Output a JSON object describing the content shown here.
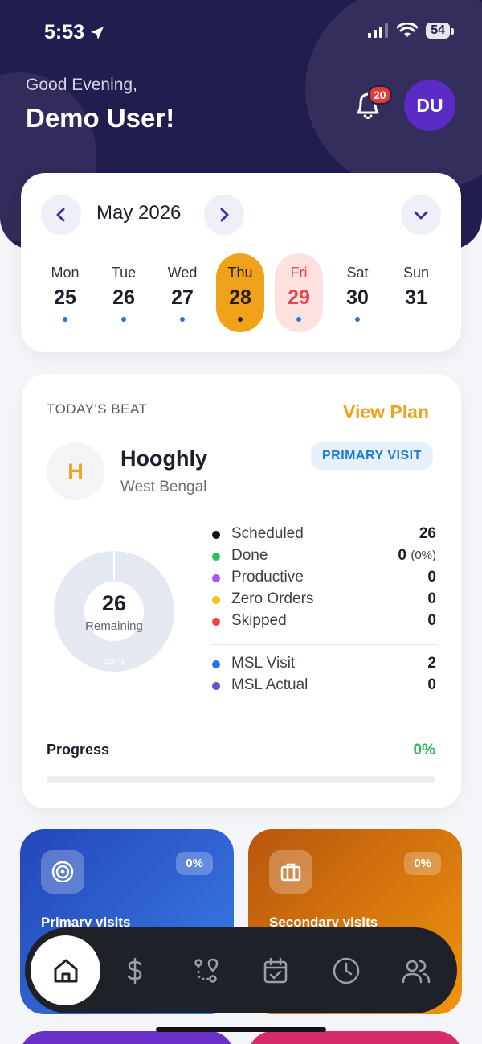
{
  "status_bar": {
    "time": "5:53",
    "battery": "54"
  },
  "header": {
    "greeting": "Good Evening,",
    "user_name": "Demo User!",
    "notification_count": "20",
    "avatar_initials": "DU"
  },
  "calendar": {
    "month_label": "May 2026",
    "days": [
      {
        "name": "Mon",
        "num": "25"
      },
      {
        "name": "Tue",
        "num": "26"
      },
      {
        "name": "Wed",
        "num": "27"
      },
      {
        "name": "Thu",
        "num": "28"
      },
      {
        "name": "Fri",
        "num": "29"
      },
      {
        "name": "Sat",
        "num": "30"
      },
      {
        "name": "Sun",
        "num": "31"
      }
    ],
    "selected_day": "Thu",
    "colors": {
      "selected": "#f0a21b",
      "today_bg": "#fde1df",
      "today_text": "#e5484d",
      "dot": "#2176e6"
    }
  },
  "beat": {
    "section_label": "TODAY'S BEAT",
    "view_plan": "View Plan",
    "initial": "H",
    "name": "Hooghly",
    "state": "West Bengal",
    "visit_type": "PRIMARY VISIT",
    "donut": {
      "count": "26",
      "label": "Remaining",
      "percent_label": "100 %",
      "remaining_fraction": 1.0
    },
    "stats": [
      {
        "label": "Scheduled",
        "value": "26",
        "color": "#111111"
      },
      {
        "label": "Done",
        "value": "0",
        "extra": "(0%)",
        "color": "#2ec05a"
      },
      {
        "label": "Productive",
        "value": "0",
        "color": "#a855f7"
      },
      {
        "label": "Zero Orders",
        "value": "0",
        "color": "#f5c518"
      },
      {
        "label": "Skipped",
        "value": "0",
        "color": "#ef4444"
      }
    ],
    "msl": [
      {
        "label": "MSL Visit",
        "value": "2",
        "color": "#2176e6"
      },
      {
        "label": "MSL Actual",
        "value": "0",
        "color": "#6a4fd0"
      }
    ],
    "progress_label": "Progress",
    "progress_percent": "0%",
    "progress_value": 0
  },
  "tiles": [
    {
      "title": "Primary visits",
      "percent": "0%",
      "icon": "target-icon"
    },
    {
      "title": "Secondary visits",
      "percent": "0%",
      "icon": "briefcase-icon"
    }
  ],
  "nav": {
    "items": [
      "home-icon",
      "dollar-icon",
      "route-icon",
      "calendar-check-icon",
      "clock-icon",
      "users-icon"
    ],
    "active": "home-icon"
  }
}
